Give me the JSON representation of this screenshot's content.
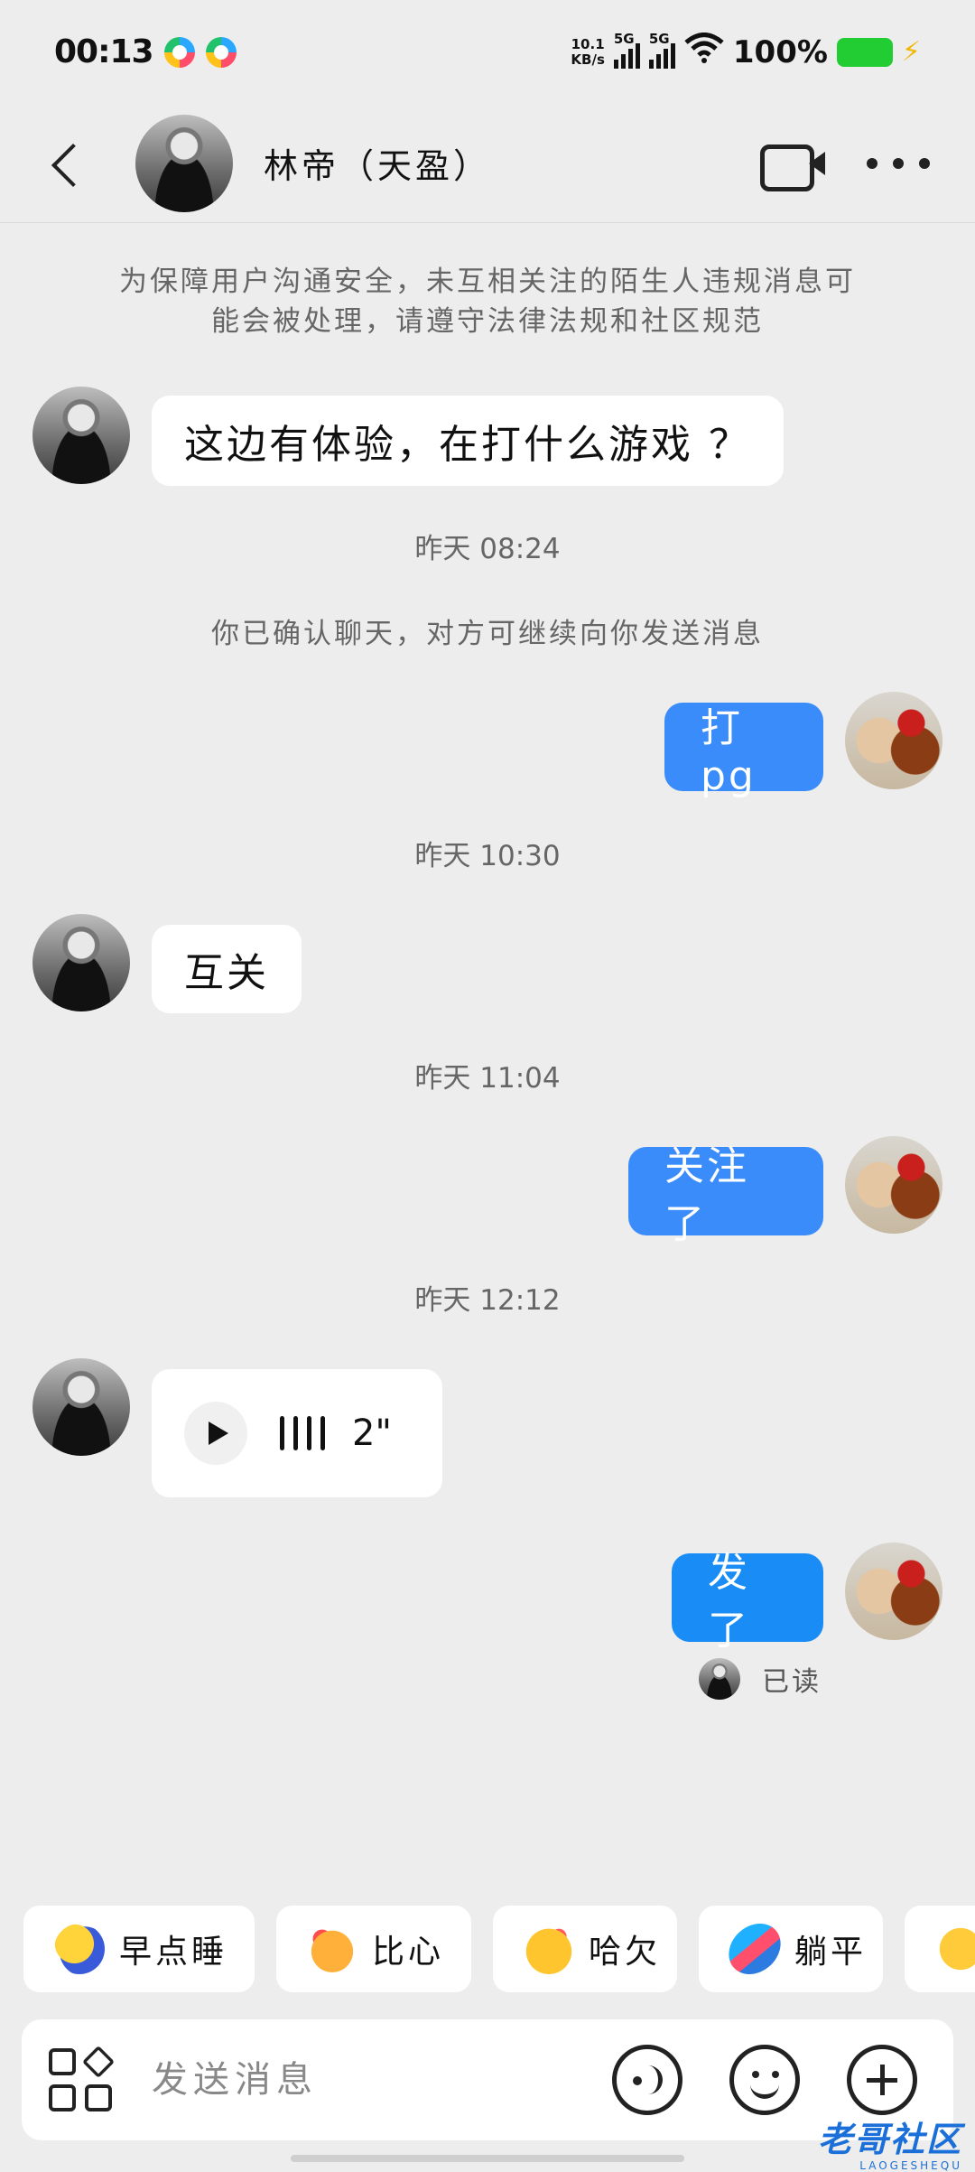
{
  "status": {
    "time": "00:13",
    "net_speed": "10.1",
    "net_unit": "KB/s",
    "sig1": "5G",
    "sig2": "5G",
    "battery": "100%"
  },
  "header": {
    "name": "林帝（天盈）"
  },
  "notice": "为保障用户沟通安全，未互相关注的陌生人违规消息可能会被处理，请遵守法律法规和社区规范",
  "messages": {
    "m1": "这边有体验，在打什么游戏 ？",
    "t1": "昨天 08:24",
    "sys1": "你已确认聊天，对方可继续向你发送消息",
    "m2": "打pg",
    "t2": "昨天 10:30",
    "m3": "互关",
    "t3": "昨天 11:04",
    "m4": "关注了",
    "t4": "昨天 12:12",
    "voice_duration": "2\"",
    "m5": "发了",
    "read": "已读"
  },
  "quick_replies": [
    {
      "label": "早点睡",
      "icon": "sleep-emoji-icon"
    },
    {
      "label": "比心",
      "icon": "heart-hands-emoji-icon"
    },
    {
      "label": "哈欠",
      "icon": "yawn-emoji-icon"
    },
    {
      "label": "躺平",
      "icon": "lie-flat-emoji-icon"
    }
  ],
  "input": {
    "placeholder": "发送消息"
  },
  "watermark": {
    "text": "老哥社区",
    "sub": "LAOGESHEQU"
  },
  "colors": {
    "outgoing_bubble": "#3b8cfb",
    "background": "#ededed"
  }
}
